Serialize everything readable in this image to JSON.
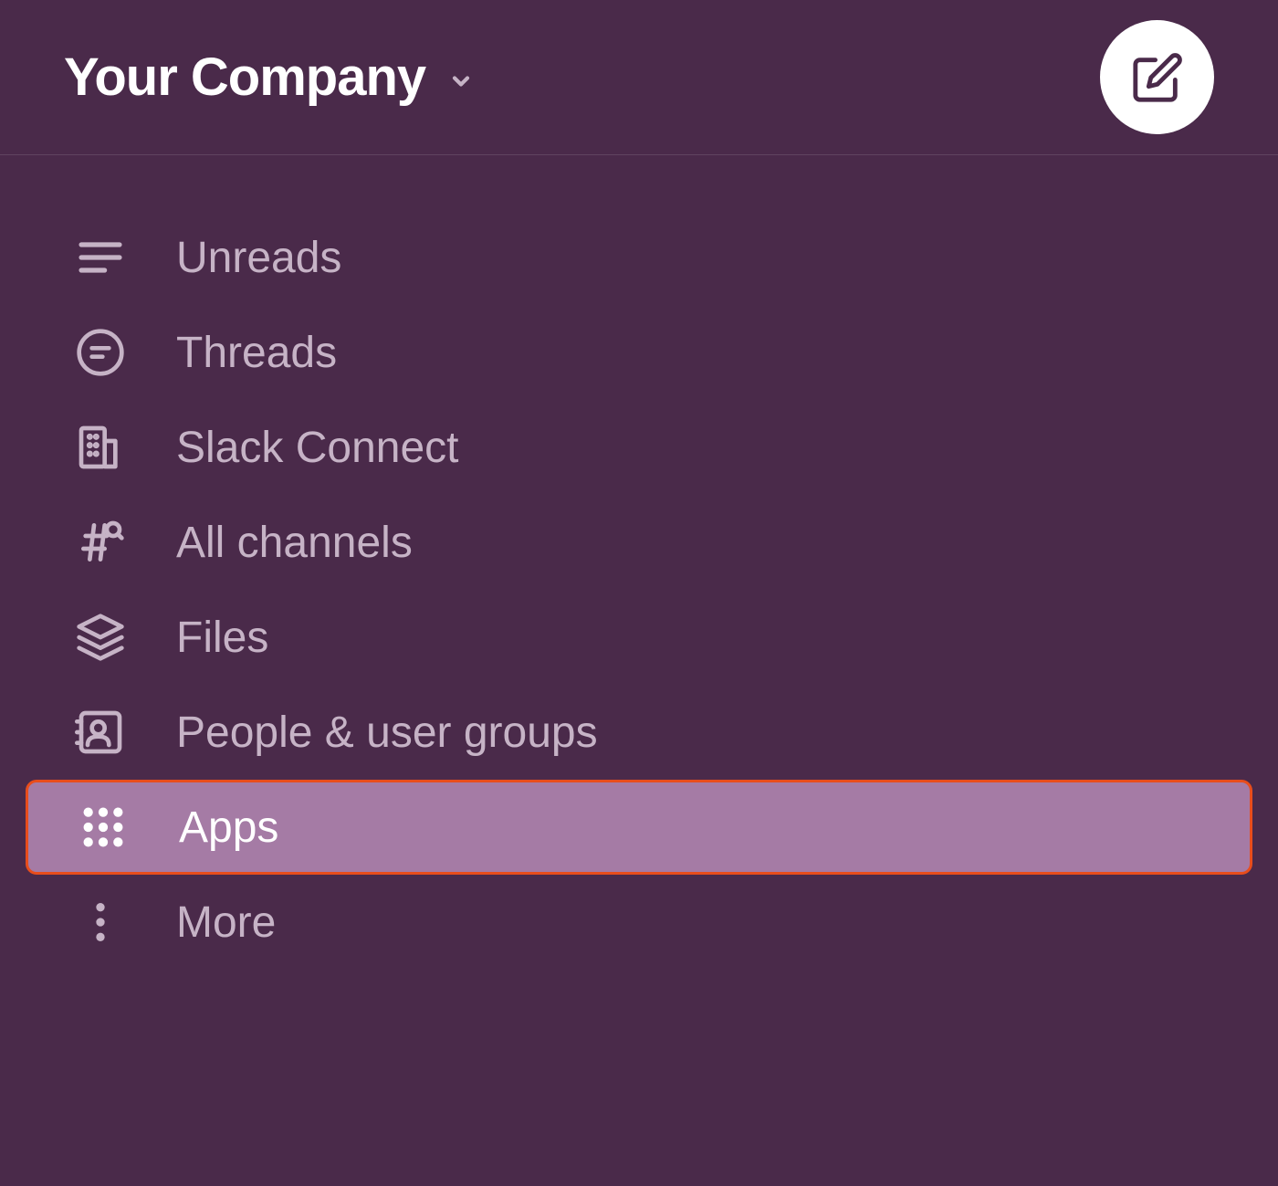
{
  "header": {
    "workspace_name": "Your Company"
  },
  "sidebar": {
    "items": [
      {
        "label": "Unreads",
        "icon": "unreads",
        "selected": false
      },
      {
        "label": "Threads",
        "icon": "threads",
        "selected": false
      },
      {
        "label": "Slack Connect",
        "icon": "slack-connect",
        "selected": false
      },
      {
        "label": "All channels",
        "icon": "all-channels",
        "selected": false
      },
      {
        "label": "Files",
        "icon": "files",
        "selected": false
      },
      {
        "label": "People & user groups",
        "icon": "people",
        "selected": false
      },
      {
        "label": "Apps",
        "icon": "apps",
        "selected": true
      },
      {
        "label": "More",
        "icon": "more",
        "selected": false
      }
    ]
  },
  "colors": {
    "background": "#4a2a4a",
    "selected_bg": "#a57ba5",
    "selected_border": "#e84d1c",
    "text": "#c6b3c6",
    "text_bright": "#ffffff"
  }
}
